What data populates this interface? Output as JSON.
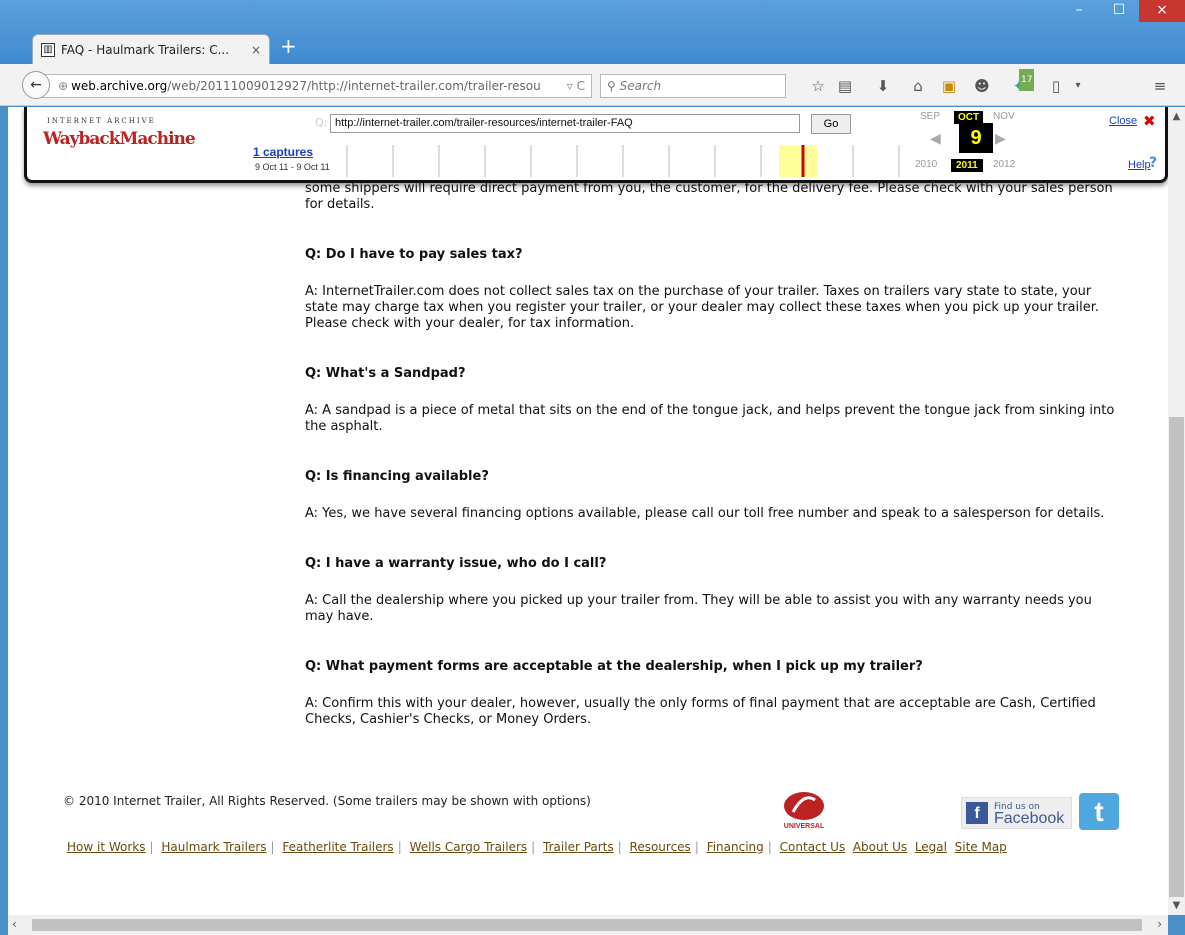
{
  "browser": {
    "tab_title": "FAQ - Haulmark Trailers: C...",
    "tab_close": "×",
    "new_tab": "+",
    "minimize": "–",
    "maximize": "☐",
    "close": "×",
    "url_domain": "web.archive.org",
    "url_prefix": "",
    "url_rest": "/web/20111009012927/http://internet-trailer.com/trailer-resou",
    "search_placeholder": "Search",
    "badge_count": "17"
  },
  "wayback": {
    "logo_top": "INTERNET ARCHIVE",
    "logo": "WaybackMachine",
    "url_value": "http://internet-trailer.com/trailer-resources/internet-trailer-FAQ",
    "go_label": "Go",
    "captures": "1 captures",
    "date_range": "9 Oct 11 - 9 Oct 11",
    "prev_month": "SEP",
    "cur_month": "OCT",
    "next_month": "NOV",
    "day": "9",
    "prev_year": "2010",
    "cur_year": "2011",
    "next_year": "2012",
    "close_label": "Close",
    "help_label": "Help"
  },
  "faq": {
    "intro_tail": "some shippers will require direct payment from you, the customer, for the delivery fee. Please check with your sales person for details.",
    "items": [
      {
        "q": "Q:  Do I have to pay sales tax?",
        "a": "A:  InternetTrailer.com does not collect sales tax on the purchase of your trailer. Taxes on trailers vary state to state, your state may charge tax when you register your trailer, or your dealer may collect these taxes when you pick up your trailer.  Please check with your dealer, for tax information."
      },
      {
        "q": "Q:  What's a Sandpad?",
        "a": "A:  A sandpad is a piece of metal that sits on the end of the tongue jack, and helps prevent the tongue jack from sinking into the asphalt."
      },
      {
        "q": "Q:  Is financing available?",
        "a": "A:  Yes, we have several financing options available, please call our toll free number and speak to a salesperson for details."
      },
      {
        "q": "Q:  I have a warranty issue, who do I call?",
        "a": "A:  Call the dealership where you picked up your trailer from.  They will be able to assist you with any warranty needs you may have."
      },
      {
        "q": "Q:  What payment forms are acceptable at the dealership, when I pick up my trailer?",
        "a": "A:  Confirm this with your dealer, however, usually the only forms of final payment that are acceptable are Cash, Certified Checks, Cashier's Checks, or Money Orders."
      }
    ]
  },
  "footer": {
    "copyright": "© 2010 Internet Trailer, All Rights Reserved.    (Some trailers may be shown with options)",
    "links": [
      "How it Works",
      "Haulmark Trailers",
      "Featherlite Trailers",
      "Wells Cargo Trailers",
      "Trailer Parts",
      "Resources",
      "Financing",
      "Contact Us",
      "About Us",
      "Legal",
      "Site Map"
    ],
    "facebook_small": "Find us on",
    "facebook_big": "Facebook",
    "universal_label": "UNIVERSAL"
  },
  "colors": {
    "accent_link": "#6b4a0f",
    "wayback_yellow": "#ffff00",
    "facebook": "#3b5998",
    "twitter": "#4fa7e0"
  }
}
